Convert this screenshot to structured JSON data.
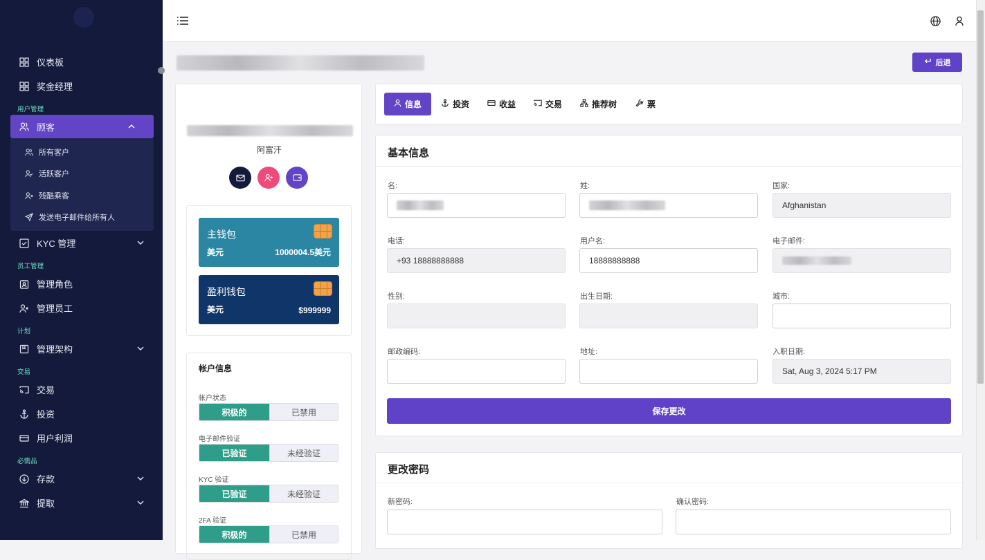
{
  "sidebar": {
    "items": [
      {
        "label": "仪表板",
        "icon": "grid-icon"
      },
      {
        "label": "奖金经理",
        "icon": "grid-icon"
      }
    ],
    "sections": {
      "user_mgmt": "用户管理",
      "staff_mgmt": "员工管理",
      "plan": "计划",
      "trade": "交易",
      "essentials": "必需品"
    },
    "customers": "顾客",
    "customer_sub": [
      "所有客户",
      "活跃客户",
      "残酷乘客",
      "发送电子邮件给所有人"
    ],
    "kyc": "KYC 管理",
    "manage_roles": "管理角色",
    "manage_staff": "管理员工",
    "manage_structure": "管理架构",
    "transactions": "交易",
    "investments": "投资",
    "user_profit": "用户利润",
    "deposit": "存款",
    "withdraw": "提取"
  },
  "header": {
    "back_label": "后退"
  },
  "profile": {
    "country": "阿富汗",
    "wallets": [
      {
        "name": "主钱包",
        "currency": "美元",
        "amount": "1000004.5美元",
        "color": "#2a86a2"
      },
      {
        "name": "盈利钱包",
        "currency": "美元",
        "amount": "$999999",
        "color": "#0f3569"
      }
    ],
    "account": {
      "title": "帐户信息",
      "rows": [
        {
          "label": "帐户状态",
          "on": "积极的",
          "off": "已禁用"
        },
        {
          "label": "电子邮件验证",
          "on": "已验证",
          "off": "未经验证"
        },
        {
          "label": "KYC 验证",
          "on": "已验证",
          "off": "未经验证"
        },
        {
          "label": "2FA 验证",
          "on": "积极的",
          "off": "已禁用"
        }
      ]
    }
  },
  "tabs": [
    "信息",
    "投资",
    "收益",
    "交易",
    "推荐树",
    "票"
  ],
  "basic": {
    "title": "基本信息",
    "labels": {
      "first_name": "名:",
      "last_name": "姓:",
      "country": "国家:",
      "phone": "电话:",
      "username": "用户名:",
      "email": "电子邮件:",
      "gender": "性别:",
      "dob": "出生日期:",
      "city": "城市:",
      "zip": "邮政编码:",
      "address": "地址:",
      "joined": "入职日期:"
    },
    "values": {
      "country": "Afghanistan",
      "phone": "+93 18888888888",
      "username": "18888888888",
      "joined": "Sat, Aug 3, 2024 5:17 PM"
    },
    "save": "保存更改"
  },
  "password": {
    "title": "更改密码",
    "new": "新密码:",
    "confirm": "确认密码:"
  },
  "colors": {
    "accent": "#6244c7",
    "sidebar": "#141a3c",
    "success": "#2e9e8a"
  }
}
